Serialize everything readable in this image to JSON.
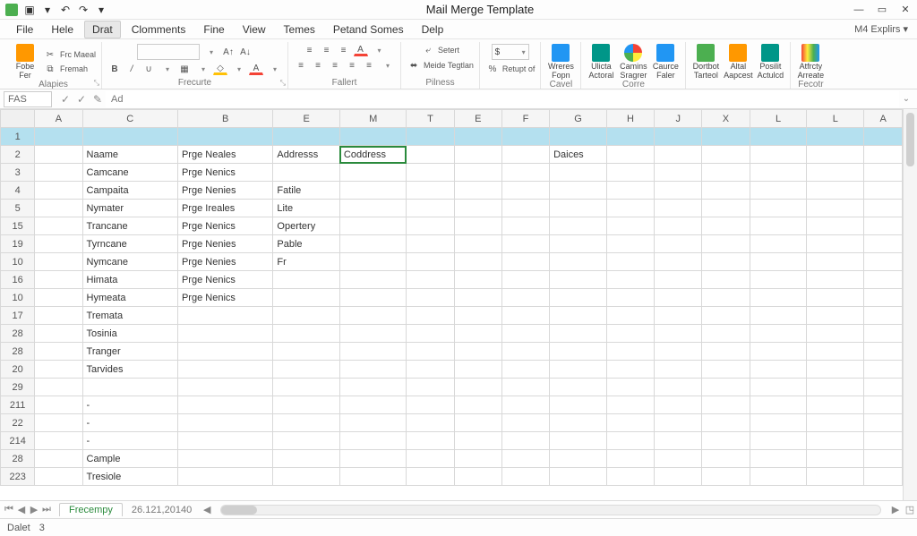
{
  "title": "Mail Merge Template",
  "topright": "M4 Explirs ▾",
  "menus": [
    "File",
    "Hele",
    "Drat",
    "Clomments",
    "Fine",
    "View",
    "Temes",
    "Petand Somes",
    "Delp"
  ],
  "menu_active_index": 2,
  "qat": {
    "save": "▣",
    "undo": "↶",
    "redo": "↷",
    "dd": "▾"
  },
  "window": {
    "min": "—",
    "restore": "▭",
    "close": "✕"
  },
  "ribbon": {
    "g1": {
      "label": "Alapies",
      "btn1": "Fobe",
      "btn1b": "Fer",
      "frc": "Frc Maeal",
      "fre": "Fremah"
    },
    "g2": {
      "label": "Frecurte",
      "font": "",
      "b": "B",
      "i": "/",
      "u": "∪",
      "s": "S",
      "fill": "A",
      "a2": "A",
      "a3": "A"
    },
    "g3": {
      "label": "Fallert",
      "r1a": "≡",
      "r1b": "≡",
      "r1c": "≡",
      "r1d": "A",
      "r2a": "≡",
      "r2b": "≡",
      "r2c": "≡",
      "r2d": "≡",
      "r2e": "≡"
    },
    "g4": {
      "label": "Pilness",
      "sel": "Setert",
      "mt": "Meide Tegtlan"
    },
    "g5": {
      "label": "",
      "num": "$",
      "ret": "Retupt of"
    },
    "g6": {
      "label": "Cavel",
      "w": "Wreres",
      "w2": "Fopn"
    },
    "g7": {
      "label": "Corre",
      "a": "Ulicta",
      "a2": "Actoral",
      "b": "Camins",
      "b2": "Sragrer",
      "c": "Caurce",
      "c2": "Faler"
    },
    "g8": {
      "label": "",
      "a": "Dortbot",
      "a2": "Tarteol",
      "b": "Altal",
      "b2": "Aapcest",
      "c": "Posilit",
      "c2": "Actulcd"
    },
    "g9": {
      "label": "Fecotr",
      "a": "Atfrcty",
      "a2": "Arreate"
    }
  },
  "formula": {
    "name": "FAS",
    "fx": "Ad",
    "cancel": "✓",
    "enter": "✓",
    "edit": "✎"
  },
  "columns": [
    "",
    "A",
    "C",
    "B",
    "E",
    "M",
    "T",
    "E",
    "F",
    "G",
    "H",
    "J",
    "X",
    "L",
    "L",
    "A"
  ],
  "rows": [
    {
      "n": "1",
      "hl": true,
      "c": [
        "",
        "",
        "",
        "",
        "",
        "",
        "",
        "",
        "",
        "",
        "",
        "",
        "",
        "",
        ""
      ]
    },
    {
      "n": "2",
      "c": [
        "",
        "Naame",
        "Prge Neales",
        "Addresss",
        "Coddress",
        "",
        "",
        "",
        "Daices",
        "",
        "",
        "",
        "",
        "",
        ""
      ],
      "active": 4
    },
    {
      "n": "3",
      "c": [
        "",
        "Camcane",
        "Prge Nenics",
        "",
        "",
        "",
        "",
        "",
        "",
        "",
        "",
        "",
        "",
        "",
        ""
      ]
    },
    {
      "n": "4",
      "c": [
        "",
        "Campaita",
        "Prge Nenies",
        "Fatile",
        "",
        "",
        "",
        "",
        "",
        "",
        "",
        "",
        "",
        "",
        ""
      ]
    },
    {
      "n": "5",
      "c": [
        "",
        "Nymater",
        "Prge Ireales",
        "Lite",
        "",
        "",
        "",
        "",
        "",
        "",
        "",
        "",
        "",
        "",
        ""
      ]
    },
    {
      "n": "15",
      "c": [
        "",
        "Trancane",
        "Prge Nenics",
        "Opertery",
        "",
        "",
        "",
        "",
        "",
        "",
        "",
        "",
        "",
        "",
        ""
      ]
    },
    {
      "n": "19",
      "c": [
        "",
        "Tyrncane",
        "Prge Nenies",
        "Pable",
        "",
        "",
        "",
        "",
        "",
        "",
        "",
        "",
        "",
        "",
        ""
      ]
    },
    {
      "n": "10",
      "c": [
        "",
        "Nymcane",
        "Prge Nenies",
        "Fr",
        "",
        "",
        "",
        "",
        "",
        "",
        "",
        "",
        "",
        "",
        ""
      ]
    },
    {
      "n": "16",
      "c": [
        "",
        "Himata",
        "Prge Nenics",
        "",
        "",
        "",
        "",
        "",
        "",
        "",
        "",
        "",
        "",
        "",
        ""
      ]
    },
    {
      "n": "10",
      "c": [
        "",
        "Hymeata",
        "Prge Nenics",
        "",
        "",
        "",
        "",
        "",
        "",
        "",
        "",
        "",
        "",
        "",
        ""
      ]
    },
    {
      "n": "17",
      "c": [
        "",
        "Tremata",
        "",
        "",
        "",
        "",
        "",
        "",
        "",
        "",
        "",
        "",
        "",
        "",
        ""
      ]
    },
    {
      "n": "28",
      "c": [
        "",
        "Tosinia",
        "",
        "",
        "",
        "",
        "",
        "",
        "",
        "",
        "",
        "",
        "",
        "",
        ""
      ]
    },
    {
      "n": "28",
      "c": [
        "",
        "Tranger",
        "",
        "",
        "",
        "",
        "",
        "",
        "",
        "",
        "",
        "",
        "",
        "",
        ""
      ]
    },
    {
      "n": "20",
      "c": [
        "",
        "Tarvides",
        "",
        "",
        "",
        "",
        "",
        "",
        "",
        "",
        "",
        "",
        "",
        "",
        ""
      ]
    },
    {
      "n": "29",
      "c": [
        "",
        "",
        "",
        "",
        "",
        "",
        "",
        "",
        "",
        "",
        "",
        "",
        "",
        "",
        ""
      ]
    },
    {
      "n": "211",
      "c": [
        "",
        "-",
        "",
        "",
        "",
        "",
        "",
        "",
        "",
        "",
        "",
        "",
        "",
        "",
        ""
      ]
    },
    {
      "n": "22",
      "c": [
        "",
        "-",
        "",
        "",
        "",
        "",
        "",
        "",
        "",
        "",
        "",
        "",
        "",
        "",
        ""
      ]
    },
    {
      "n": "214",
      "c": [
        "",
        "-",
        "",
        "",
        "",
        "",
        "",
        "",
        "",
        "",
        "",
        "",
        "",
        "",
        ""
      ]
    },
    {
      "n": "28",
      "c": [
        "",
        "Cample",
        "",
        "",
        "",
        "",
        "",
        "",
        "",
        "",
        "",
        "",
        "",
        "",
        ""
      ]
    },
    {
      "n": "223",
      "c": [
        "",
        "Tresiole",
        "",
        "",
        "",
        "",
        "",
        "",
        "",
        "",
        "",
        "",
        "",
        "",
        ""
      ]
    }
  ],
  "tabs": {
    "nav": [
      "⏮",
      "◀",
      "▶",
      "⏭"
    ],
    "sheet": "Frecempy",
    "info": "26.121,20140"
  },
  "status": {
    "mode": "Dalet",
    "count": "3"
  }
}
